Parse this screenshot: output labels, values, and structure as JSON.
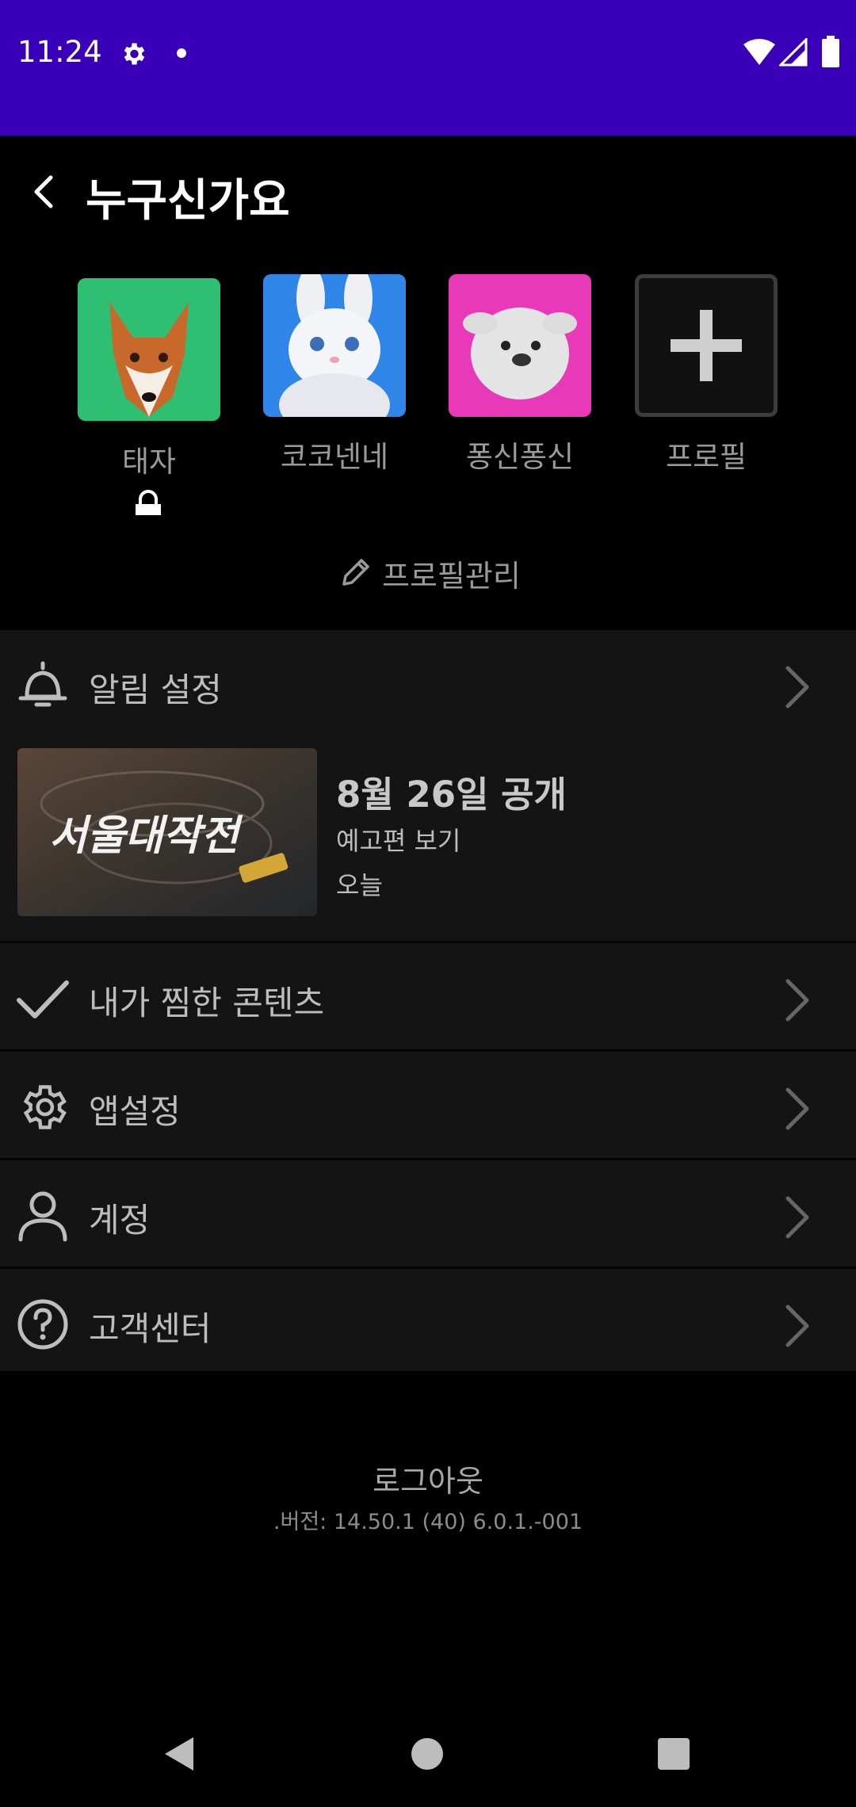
{
  "status_bar": {
    "time": "11:24"
  },
  "header": {
    "title": "누구신가요"
  },
  "profiles": [
    {
      "name": "태자",
      "avatar": "fox-avatar",
      "color": "#2fbf73"
    },
    {
      "name": "코코넨네",
      "avatar": "bunny-avatar",
      "color": "#2f86e8"
    },
    {
      "name": "퐁신퐁신",
      "avatar": "fluffy-avatar",
      "color": "#e83ab8"
    },
    {
      "name": "프로필",
      "avatar": "add-profile-icon"
    }
  ],
  "manage_profiles": "프로필관리",
  "menu": {
    "notifications": "알림 설정",
    "wishlist": "내가 찜한 콘텐츠",
    "app_settings": "앱설정",
    "account": "계정",
    "help": "고객센터"
  },
  "notice": {
    "thumb_title": "서울대작전",
    "title": "8월 26일 공개",
    "subtitle": "예고편 보기",
    "date": "오늘"
  },
  "footer": {
    "logout": "로그아웃",
    "version": ".버전: 14.50.1 (40) 6.0.1.-001"
  },
  "colors": {
    "status_bar": "#3a00b8",
    "panel": "#141414",
    "text_muted": "#9a9a9a"
  }
}
